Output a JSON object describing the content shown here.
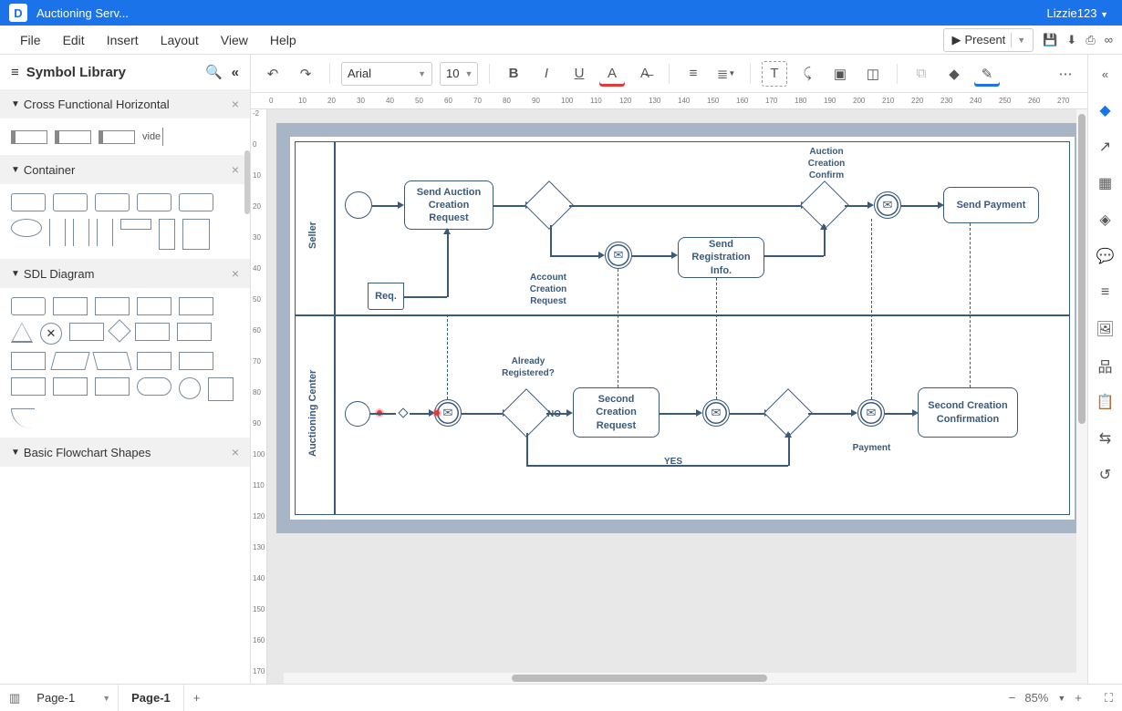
{
  "topbar": {
    "doc_title": "Auctioning Serv...",
    "user": "Lizzie123"
  },
  "menu": {
    "file": "File",
    "edit": "Edit",
    "insert": "Insert",
    "layout": "Layout",
    "view": "View",
    "help": "Help",
    "present": "Present"
  },
  "symbol_library": {
    "title": "Symbol Library",
    "sections": {
      "cross_functional": "Cross Functional Horizontal",
      "container": "Container",
      "sdl": "SDL Diagram",
      "basic": "Basic Flowchart Shapes",
      "vide_label": "vide"
    }
  },
  "toolbar": {
    "font": "Arial",
    "size": "10"
  },
  "diagram": {
    "lanes": {
      "seller": "Seller",
      "auction_center": "Auctioning Center"
    },
    "nodes": {
      "send_auction_creation": "Send Auction Creation Request",
      "auction_creation_confirm": "Auction Creation Confirm",
      "send_payment": "Send Payment",
      "send_registration": "Send Registration Info.",
      "account_creation_request": "Account Creation Request",
      "req": "Req.",
      "already_registered": "Already Registered?",
      "second_creation_request": "Second Creation Request",
      "second_creation_confirmation": "Second Creation Confirmation",
      "payment": "Payment",
      "no": "NO",
      "yes": "YES"
    }
  },
  "tabs": {
    "page_select": "Page-1",
    "page_tab": "Page-1"
  },
  "zoom": {
    "value": "85%"
  },
  "ruler_h": [
    "0",
    "10",
    "20",
    "30",
    "40",
    "50",
    "60",
    "70",
    "80",
    "90",
    "100",
    "110",
    "120",
    "130",
    "140",
    "150",
    "160",
    "170",
    "180",
    "190",
    "200",
    "210",
    "220",
    "230",
    "240",
    "250",
    "260",
    "270"
  ],
  "ruler_v": [
    "-2",
    "0",
    "10",
    "20",
    "30",
    "40",
    "50",
    "60",
    "70",
    "80",
    "90",
    "100",
    "110",
    "120",
    "130",
    "140",
    "150",
    "160",
    "170"
  ]
}
